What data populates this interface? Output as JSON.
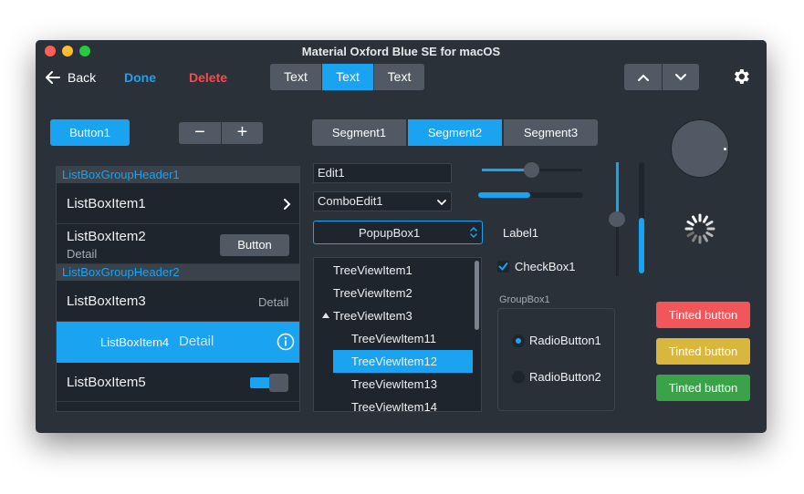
{
  "window": {
    "title": "Material Oxford Blue SE for macOS"
  },
  "toolbar": {
    "back_label": "Back",
    "done_label": "Done",
    "delete_label": "Delete",
    "segments": [
      "Text",
      "Text",
      "Text"
    ],
    "selected_segment": 1
  },
  "controls": {
    "button1_label": "Button1",
    "minus_symbol": "−",
    "plus_symbol": "+",
    "segments": [
      "Segment1",
      "Segment2",
      "Segment3"
    ],
    "selected_segment": 1
  },
  "listbox": {
    "group1_header": "ListBoxGroupHeader1",
    "group2_header": "ListBoxGroupHeader2",
    "item1": "ListBoxItem1",
    "item2": "ListBoxItem2",
    "item2_detail": "Detail",
    "item2_button": "Button",
    "item3": "ListBoxItem3",
    "item3_detail": "Detail",
    "item4": "ListBoxItem4",
    "item4_detail": "Detail",
    "item5": "ListBoxItem5"
  },
  "fields": {
    "edit1_value": "Edit1",
    "comboedit1_value": "ComboEdit1",
    "popupbox1_value": "PopupBox1",
    "label1": "Label1",
    "checkbox1_label": "CheckBox1"
  },
  "tree": {
    "items": [
      "TreeViewItem1",
      "TreeViewItem2",
      "TreeViewItem3",
      "TreeViewItem11",
      "TreeViewItem12",
      "TreeViewItem13",
      "TreeViewItem14"
    ],
    "selected": "TreeViewItem12"
  },
  "groupbox": {
    "title": "GroupBox1",
    "radio1_label": "RadioButton1",
    "radio2_label": "RadioButton2"
  },
  "sliders": {
    "h1_value": 0.5,
    "h2_value": 0.5,
    "v1_value": 0.5,
    "v2_value": 0.5
  },
  "tinted": {
    "red_label": "Tinted button",
    "yellow_label": "Tinted button",
    "green_label": "Tinted button"
  },
  "colors": {
    "accent": "#1aa3f0",
    "background": "#2b3139",
    "control": "#515a64",
    "delete": "#ff4848",
    "tinted_red": "#f0565a",
    "tinted_yellow": "#d9b63c",
    "tinted_green": "#3aa34a"
  },
  "icons": {
    "back": "arrow-left-icon",
    "settings": "gear-icon",
    "chevron_up": "chevron-up-icon",
    "chevron_down": "chevron-down-icon",
    "info": "info-icon",
    "spinner": "activity-spinner-icon"
  }
}
